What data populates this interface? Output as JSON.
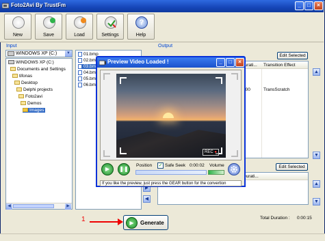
{
  "window": {
    "title": "Foto2Avi By TrustFm"
  },
  "toolbar": {
    "new_label": "New",
    "save_label": "Save",
    "load_label": "Load",
    "settings_label": "Settings",
    "help_label": "Help"
  },
  "input": {
    "group_label": "Input",
    "drive_value": "WINDOWS XP (C:)",
    "tree": [
      "WINDOWS XP (C:)",
      "Documents and Settings",
      "tifonas",
      "Desktop",
      "Delphi projects",
      "Foto2avi",
      "Demos",
      "Images"
    ],
    "files": [
      "01.bmp",
      "02.bm",
      "03.bm",
      "04.bm",
      "05.bm",
      "06.bm"
    ]
  },
  "output": {
    "group_label": "Output",
    "edit_selected_label": "Edit Selected",
    "col_dura": "Durati...",
    "col_transition": "Transition Effect",
    "row_dura": "000",
    "row_transition": "TransScratch",
    "edit_selected2_label": "Edit Selected",
    "col_dura2": "Durati..."
  },
  "preview": {
    "title": "Preview Video Loaded !",
    "rec_label": "REC",
    "position_label": "Position",
    "safe_seek_label": "Safe Seek",
    "time_value": "0:00:02",
    "volume_label": "Volume",
    "status_text": "If you like the preview, just press the GEAR button for the convertion"
  },
  "bottom": {
    "generate_label": "Generate",
    "annotation_number": "1",
    "total_duration_label": "Total Duration :",
    "total_duration_value": "0:00:15"
  }
}
